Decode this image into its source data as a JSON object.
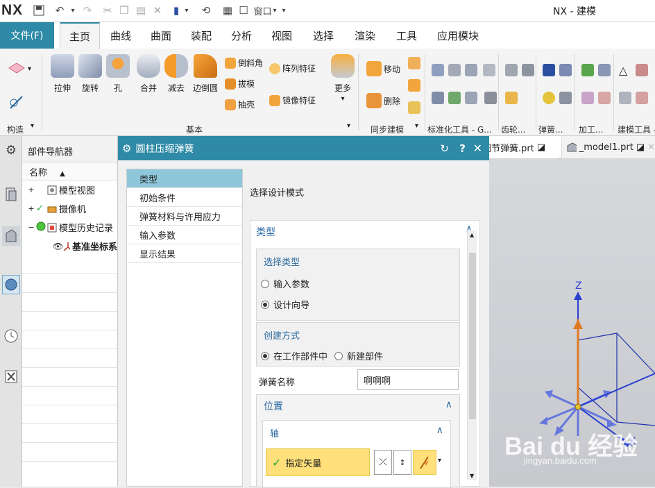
{
  "app": {
    "logo": "NX",
    "title": "NX - 建模",
    "window_menu": "窗口"
  },
  "tabs": {
    "file": "文件(F)",
    "items": [
      "主页",
      "曲线",
      "曲面",
      "装配",
      "分析",
      "视图",
      "选择",
      "渲染",
      "工具",
      "应用模块"
    ],
    "active": "主页"
  },
  "ribbon": {
    "big_buttons": [
      "拉伸",
      "旋转",
      "孔",
      "合并",
      "减去",
      "边倒圆"
    ],
    "small_buttons": [
      "倒斜角",
      "拔模",
      "抽壳",
      "阵列特征",
      "镜像特征"
    ],
    "more": "更多",
    "sync_buttons": [
      "移动",
      "删除"
    ],
    "groups": [
      "构造",
      "基本",
      "同步建模",
      "标准化工具 - G...",
      "齿轮...",
      "弹簧...",
      "加工...",
      "建模工具 -"
    ]
  },
  "navigator": {
    "title": "部件导航器",
    "column": "名称",
    "items": [
      "模型视图",
      "摄像机",
      "模型历史记录",
      "基准坐标系"
    ]
  },
  "dialog": {
    "title": "圆柱压缩弹簧",
    "steps": [
      "类型",
      "初始条件",
      "弹簧材料与许用应力",
      "输入参数",
      "显示结果"
    ],
    "mode_label": "选择设计模式",
    "type_section": "类型",
    "select_type": {
      "label": "选择类型",
      "options": [
        "输入参数",
        "设计向导"
      ],
      "selected": "设计向导"
    },
    "create_method": {
      "label": "创建方式",
      "options": [
        "在工作部件中",
        "新建部件"
      ],
      "selected": "在工作部件中"
    },
    "spring_name": {
      "label": "弹簧名称",
      "value": "啊啊啊"
    },
    "position_section": "位置",
    "axis_section": "轴",
    "vector_label": "指定矢量"
  },
  "doc_tabs": [
    "调节弹簧.prt",
    "_model1.prt"
  ],
  "viewport": {
    "axes": {
      "z": "Z",
      "x": "X"
    },
    "watermark": "Bai du 经验",
    "watermark_url": "jingyan.baidu.com"
  },
  "colors": {
    "accent": "#2e8aa6",
    "highlight": "#ffe07a",
    "step_active": "#8ec6da"
  }
}
